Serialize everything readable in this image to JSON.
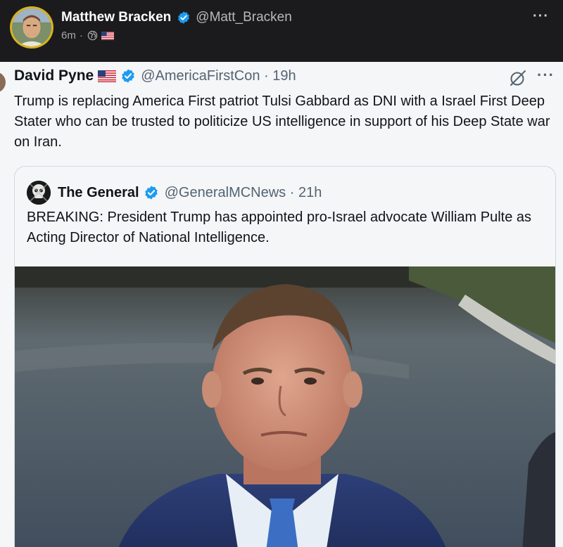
{
  "post": {
    "author_name": "Matthew Bracken",
    "author_handle": "@Matt_Bracken",
    "time": "6m",
    "dot": "·",
    "more_label": "···"
  },
  "tweet": {
    "name": "David Pyne",
    "handle": "@AmericaFirstCon · 19h",
    "text": "Trump is replacing America First patriot Tulsi Gabbard as DNI with a Israel First Deep Stater who can be trusted to politicize US intelligence in support of his Deep State war on Iran.",
    "more_label": "···"
  },
  "quoted": {
    "name": "The General",
    "handle": "@GeneralMCNews · 21h",
    "text": "BREAKING: President Trump has appointed pro-Israel advocate William Pulte as Acting Director of National Intelligence."
  },
  "icons": {
    "verified": "verified-badge-icon",
    "globe": "globe-icon",
    "flag": "us-flag-icon",
    "grok": "grok-icon",
    "more": "more-options-icon"
  },
  "colors": {
    "dark_bg": "#1b1b1d",
    "verified_blue": "#1d9bf0",
    "avatar_ring": "#d8b21e",
    "light_bg": "#f5f6f8"
  }
}
